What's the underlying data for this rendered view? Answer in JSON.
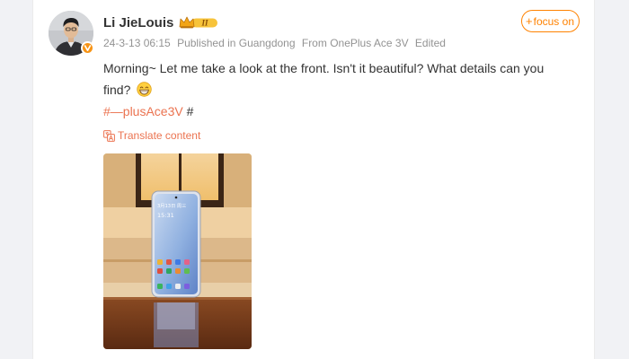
{
  "post": {
    "author": {
      "name": "Li JieLouis",
      "vip_level": "II"
    },
    "meta": {
      "timestamp": "24-3-13 06:15",
      "location": "Published in Guangdong",
      "source": "From OnePlus Ace 3V",
      "edited": "Edited"
    },
    "follow_label": "focus on",
    "text": "Morning~ Let me take a look at the front. Isn't it beautiful? What details can you find?",
    "hashtag": {
      "link_text": "#—plusAce3V",
      "closing": " #"
    },
    "translate_label": "Translate content",
    "photo": {
      "phone_screen_date": "3月13日 周三",
      "phone_screen_time": "15:31"
    }
  },
  "colors": {
    "accent_orange": "#ff8200",
    "link_orange": "#eb7350",
    "meta_gray": "#939393",
    "text_dark": "#333333",
    "verified_badge": "#f79416"
  },
  "icons": [
    "verified-v-icon",
    "vip-crown-icon",
    "grin-emoji-icon",
    "translate-icon",
    "plus-icon"
  ]
}
